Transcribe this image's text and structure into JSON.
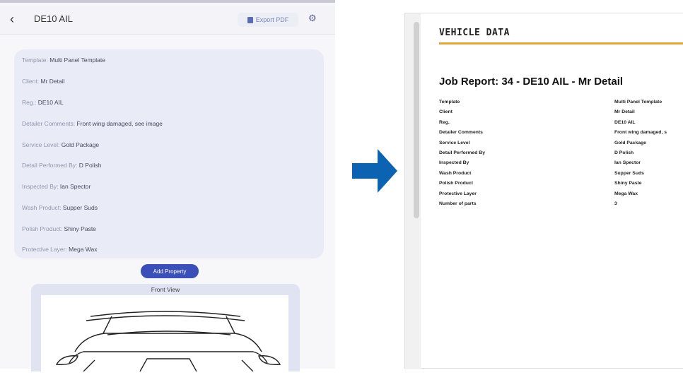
{
  "app": {
    "title": "DE10 AIL",
    "export_label": "Export PDF",
    "icons": {
      "back": "chevron-left-icon",
      "export": "pdf-icon",
      "settings": "settings-icon"
    }
  },
  "details": {
    "rows": [
      {
        "label": "Template:",
        "value": "Multi Panel Template"
      },
      {
        "label": "Client:",
        "value": "Mr Detail"
      },
      {
        "label": "Reg.:",
        "value": "DE10 AIL"
      },
      {
        "label": "Detailer Comments:",
        "value": "Front wing damaged, see image"
      },
      {
        "label": "Service Level:",
        "value": "Gold Package"
      },
      {
        "label": "Detail Performed By:",
        "value": "D Polish"
      },
      {
        "label": "Inspected By:",
        "value": "Ian Spector"
      },
      {
        "label": "Wash Product:",
        "value": "Supper Suds"
      },
      {
        "label": "Polish Product:",
        "value": "Shiny Paste"
      },
      {
        "label": "Protective Layer:",
        "value": "Mega Wax"
      }
    ],
    "add_button": "Add Property",
    "diagram_title": "Front View"
  },
  "report": {
    "header": "VEHICLE DATA",
    "job_title": "Job Report: 34 - DE10 AIL - Mr Detail",
    "rows": [
      {
        "key": "Template",
        "value": "Multi Panel Template"
      },
      {
        "key": "Client",
        "value": "Mr Detail"
      },
      {
        "key": "Reg.",
        "value": "DE10 AIL"
      },
      {
        "key": "Detailer Comments",
        "value": "Front wing damaged, s"
      },
      {
        "key": "Service Level",
        "value": "Gold Package"
      },
      {
        "key": "Detail Performed By",
        "value": "D Polish"
      },
      {
        "key": "Inspected By",
        "value": "Ian Spector"
      },
      {
        "key": "Wash Product",
        "value": "Supper Suds"
      },
      {
        "key": "Polish Product",
        "value": "Shiny Paste"
      },
      {
        "key": "Protective Layer",
        "value": "Mega Wax"
      },
      {
        "key": "Number of parts",
        "value": "3"
      }
    ]
  },
  "colors": {
    "accent_blue": "#3b4fb8",
    "arrow_blue": "#0b63b1",
    "report_rule": "#e3a43a"
  }
}
